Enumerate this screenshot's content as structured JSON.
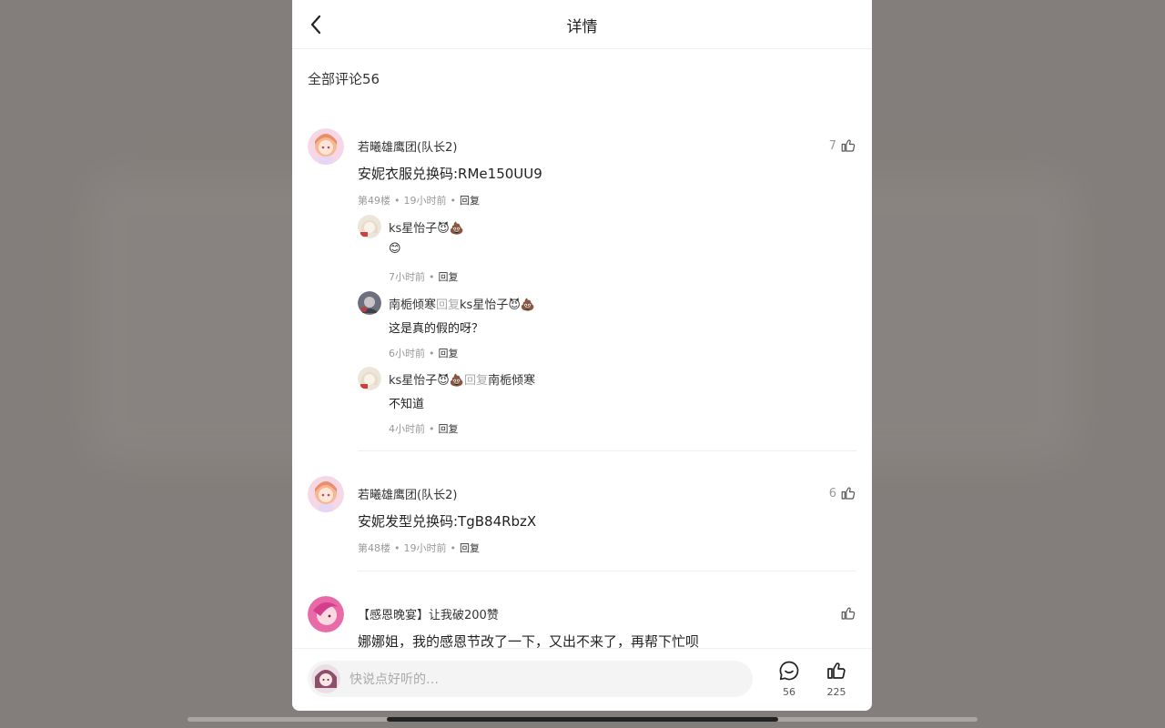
{
  "header": {
    "title": "详情"
  },
  "section": {
    "label": "全部评论",
    "count": "56"
  },
  "comments": [
    {
      "user": "若曦雄鹰团(队长2)",
      "likes": "7",
      "text": "安妮衣服兑换码:RMe150UU9",
      "floor": "第49楼",
      "time": "19小时前",
      "reply_label": "回复",
      "replies": [
        {
          "user": "ks星怡子😈💩",
          "reply_word": "",
          "target": "",
          "text": "😊",
          "time": "7小时前",
          "reply_label": "回复"
        },
        {
          "user": "南栀倾寒",
          "reply_word": "回复",
          "target": "ks星怡子😈💩",
          "text": "这是真的假的呀？",
          "time": "6小时前",
          "reply_label": "回复"
        },
        {
          "user": "ks星怡子😈💩",
          "reply_word": "回复",
          "target": "南栀倾寒",
          "text": "不知道",
          "time": "4小时前",
          "reply_label": "回复"
        }
      ]
    },
    {
      "user": "若曦雄鹰团(队长2)",
      "likes": "6",
      "text": "安妮发型兑换码:TgB84RbzX",
      "floor": "第48楼",
      "time": "19小时前",
      "reply_label": "回复"
    },
    {
      "user": "【感恩晚宴】让我破200赞",
      "likes": "",
      "text": "娜娜姐，我的感恩节改了一下，又出不来了，再帮下忙呗"
    }
  ],
  "bottom": {
    "placeholder": "快说点好听的…",
    "comment_count": "56",
    "like_count": "225"
  },
  "colors": {
    "backdrop": "#837e7b",
    "panel": "#ffffff",
    "accent_text": "#222222"
  }
}
